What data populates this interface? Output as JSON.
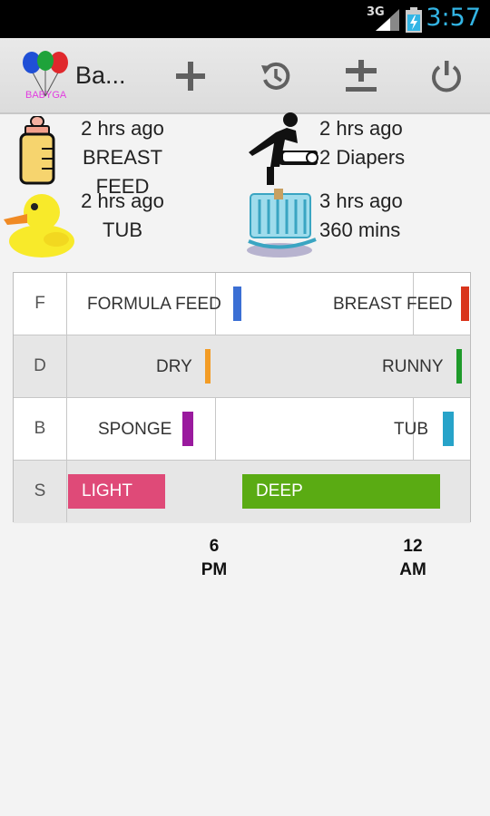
{
  "status_bar": {
    "network": "3G",
    "time": "3:57"
  },
  "action_bar": {
    "app_title": "Ba...",
    "logo_text": "BABYGA",
    "actions": [
      "add-icon",
      "history-icon",
      "plus-minus-icon",
      "power-icon"
    ]
  },
  "summaries": {
    "feed": {
      "time": "2 hrs ago",
      "detail": "BREAST FEED"
    },
    "diaper": {
      "time": "2 hrs ago",
      "detail": "2 Diapers"
    },
    "bath": {
      "time": "2 hrs ago",
      "detail": "TUB"
    },
    "sleep": {
      "time": "3 hrs ago",
      "detail": "360 mins"
    }
  },
  "timeline": {
    "rows": [
      {
        "label": "F",
        "events": [
          {
            "text": "FORMULA FEED",
            "color": "#3b6fd4"
          },
          {
            "text": "BREAST FEED",
            "color": "#d9351c"
          }
        ]
      },
      {
        "label": "D",
        "events": [
          {
            "text": "DRY",
            "color": "#f39c25"
          },
          {
            "text": "RUNNY",
            "color": "#1e9a2a"
          }
        ]
      },
      {
        "label": "B",
        "events": [
          {
            "text": "SPONGE",
            "color": "#9a1a9e"
          },
          {
            "text": "TUB",
            "color": "#27a3c9"
          }
        ]
      },
      {
        "label": "S",
        "events": [
          {
            "text": "LIGHT",
            "color": "#df4a78"
          },
          {
            "text": "DEEP",
            "color": "#5aab13"
          }
        ]
      }
    ],
    "axis_labels": [
      {
        "hour": "6",
        "period": "PM"
      },
      {
        "hour": "12",
        "period": "AM"
      }
    ]
  }
}
